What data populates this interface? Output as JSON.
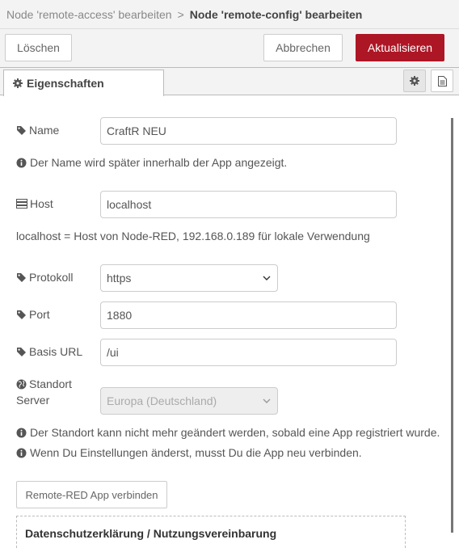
{
  "breadcrumb": {
    "parent": "Node 'remote-access' bearbeiten",
    "separator": ">",
    "current": "Node 'remote-config' bearbeiten"
  },
  "toolbar": {
    "delete_label": "Löschen",
    "cancel_label": "Abbrechen",
    "update_label": "Aktualisieren"
  },
  "tabs": {
    "properties_label": "Eigenschaften",
    "settings_icon": "gear-icon",
    "description_icon": "file-text-icon"
  },
  "form": {
    "name": {
      "label": "Name",
      "value": "CraftR NEU",
      "icon": "tag-icon"
    },
    "name_hint": "Der Name wird später innerhalb der App angezeigt.",
    "host": {
      "label": "Host",
      "value": "localhost",
      "icon": "server-icon"
    },
    "host_hint": "localhost = Host von Node-RED, 192.168.0.189 für lokale Verwendung",
    "protocol": {
      "label": "Protokoll",
      "value": "https",
      "icon": "tag-icon"
    },
    "port": {
      "label": "Port",
      "value": "1880",
      "icon": "tag-icon"
    },
    "base_url": {
      "label": "Basis URL",
      "value": "/ui",
      "icon": "tag-icon"
    },
    "location": {
      "label_line1": "Standort",
      "label_line2": "Server",
      "value": "Europa (Deutschland)",
      "icon": "globe-icon",
      "disabled": true
    },
    "location_hint": "Der Standort kann nicht mehr geändert werden, sobald eine App registriert wurde.",
    "reconnect_hint": "Wenn Du Einstellungen änderst, musst Du die App neu verbinden.",
    "connect_button": "Remote-RED App verbinden",
    "privacy_title": "Datenschutzerklärung / Nutzungsvereinbarung"
  },
  "colors": {
    "primary": "#ad1625",
    "panel_bg": "#f3f3f3",
    "text": "#555555"
  }
}
